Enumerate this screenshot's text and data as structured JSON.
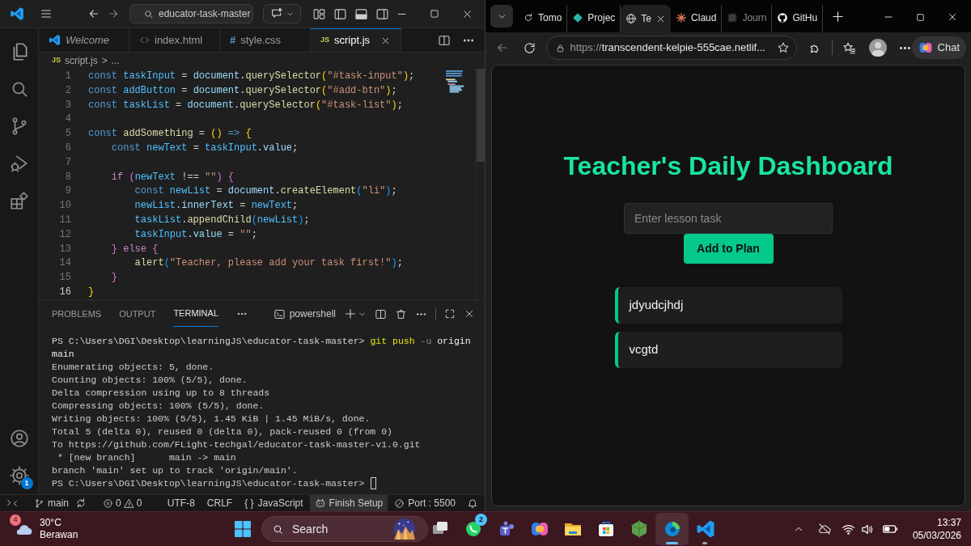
{
  "editor": {
    "search": "educator-task-master",
    "tabs": [
      {
        "kind": "welcome",
        "label": "Welcome",
        "selected": false
      },
      {
        "kind": "html",
        "label": "index.html",
        "selected": false
      },
      {
        "kind": "css",
        "badge": "#",
        "label": "style.css",
        "selected": false
      },
      {
        "kind": "js",
        "badge": "JS",
        "label": "script.js",
        "selected": true
      }
    ],
    "breadcrumb": {
      "badge": "JS",
      "file": "script.js",
      "separator": ">",
      "rest": "..."
    },
    "code_lines": [
      {
        "number": "1",
        "current": false,
        "segments": [
          {
            "kind": "kw",
            "text": "const "
          },
          {
            "kind": "cst",
            "text": "taskInput"
          },
          {
            "kind": "p",
            "text": " = "
          },
          {
            "kind": "var",
            "text": "document"
          },
          {
            "kind": "p",
            "text": "."
          },
          {
            "kind": "fn",
            "text": "querySelector"
          },
          {
            "kind": "b1",
            "text": "("
          },
          {
            "kind": "str",
            "text": "\"#task-input\""
          },
          {
            "kind": "b1",
            "text": ")"
          },
          {
            "kind": "p",
            "text": ";"
          }
        ]
      },
      {
        "number": "2",
        "current": false,
        "segments": [
          {
            "kind": "kw",
            "text": "const "
          },
          {
            "kind": "cst",
            "text": "addButton"
          },
          {
            "kind": "p",
            "text": " = "
          },
          {
            "kind": "var",
            "text": "document"
          },
          {
            "kind": "p",
            "text": "."
          },
          {
            "kind": "fn",
            "text": "querySelector"
          },
          {
            "kind": "b1",
            "text": "("
          },
          {
            "kind": "str",
            "text": "\"#add-btn\""
          },
          {
            "kind": "b1",
            "text": ")"
          },
          {
            "kind": "p",
            "text": ";"
          }
        ]
      },
      {
        "number": "3",
        "current": false,
        "segments": [
          {
            "kind": "kw",
            "text": "const "
          },
          {
            "kind": "cst",
            "text": "taskList"
          },
          {
            "kind": "p",
            "text": " = "
          },
          {
            "kind": "var",
            "text": "document"
          },
          {
            "kind": "p",
            "text": "."
          },
          {
            "kind": "fn",
            "text": "querySelector"
          },
          {
            "kind": "b1",
            "text": "("
          },
          {
            "kind": "str",
            "text": "\"#task-list\""
          },
          {
            "kind": "b1",
            "text": ")"
          },
          {
            "kind": "p",
            "text": ";"
          }
        ]
      },
      {
        "number": "4",
        "current": false
      },
      {
        "number": "5",
        "current": false,
        "segments": [
          {
            "kind": "kw",
            "text": "const "
          },
          {
            "kind": "fn",
            "text": "addSomething"
          },
          {
            "kind": "p",
            "text": " = "
          },
          {
            "kind": "b1",
            "text": "() "
          },
          {
            "kind": "kw",
            "text": "=> "
          },
          {
            "kind": "b1",
            "text": "{"
          }
        ]
      },
      {
        "number": "6",
        "current": false,
        "segments": [
          {
            "kind": "kw",
            "text": "    const "
          },
          {
            "kind": "cst",
            "text": "newText"
          },
          {
            "kind": "p",
            "text": " = "
          },
          {
            "kind": "cst",
            "text": "taskInput"
          },
          {
            "kind": "p",
            "text": "."
          },
          {
            "kind": "var",
            "text": "value"
          },
          {
            "kind": "p",
            "text": ";"
          }
        ]
      },
      {
        "number": "7",
        "current": false
      },
      {
        "number": "8",
        "current": false,
        "segments": [
          {
            "kind": "ctl",
            "text": "    if "
          },
          {
            "kind": "b2",
            "text": "("
          },
          {
            "kind": "cst",
            "text": "newText"
          },
          {
            "kind": "p",
            "text": " !== "
          },
          {
            "kind": "str",
            "text": "\"\""
          },
          {
            "kind": "b2",
            "text": ") {"
          }
        ]
      },
      {
        "number": "9",
        "current": false,
        "segments": [
          {
            "kind": "kw",
            "text": "        const "
          },
          {
            "kind": "cst",
            "text": "newList"
          },
          {
            "kind": "p",
            "text": " = "
          },
          {
            "kind": "var",
            "text": "document"
          },
          {
            "kind": "p",
            "text": "."
          },
          {
            "kind": "fn",
            "text": "createElement"
          },
          {
            "kind": "b3",
            "text": "("
          },
          {
            "kind": "str",
            "text": "\"li\""
          },
          {
            "kind": "b3",
            "text": ")"
          },
          {
            "kind": "p",
            "text": ";"
          }
        ]
      },
      {
        "number": "10",
        "current": false,
        "segments": [
          {
            "kind": "cst",
            "text": "        newList"
          },
          {
            "kind": "p",
            "text": "."
          },
          {
            "kind": "var",
            "text": "innerText"
          },
          {
            "kind": "p",
            "text": " = "
          },
          {
            "kind": "cst",
            "text": "newText"
          },
          {
            "kind": "p",
            "text": ";"
          }
        ]
      },
      {
        "number": "11",
        "current": false,
        "segments": [
          {
            "kind": "cst",
            "text": "        taskList"
          },
          {
            "kind": "p",
            "text": "."
          },
          {
            "kind": "fn",
            "text": "appendChild"
          },
          {
            "kind": "b3",
            "text": "("
          },
          {
            "kind": "cst",
            "text": "newList"
          },
          {
            "kind": "b3",
            "text": ")"
          },
          {
            "kind": "p",
            "text": ";"
          }
        ]
      },
      {
        "number": "12",
        "current": false,
        "segments": [
          {
            "kind": "cst",
            "text": "        taskInput"
          },
          {
            "kind": "p",
            "text": "."
          },
          {
            "kind": "var",
            "text": "value"
          },
          {
            "kind": "p",
            "text": " = "
          },
          {
            "kind": "str",
            "text": "\"\""
          },
          {
            "kind": "p",
            "text": ";"
          }
        ]
      },
      {
        "number": "13",
        "current": false,
        "segments": [
          {
            "kind": "b2",
            "text": "    } "
          },
          {
            "kind": "ctl",
            "text": "else "
          },
          {
            "kind": "b2",
            "text": "{"
          }
        ]
      },
      {
        "number": "14",
        "current": false,
        "segments": [
          {
            "kind": "fn",
            "text": "        alert"
          },
          {
            "kind": "b3",
            "text": "("
          },
          {
            "kind": "str",
            "text": "\"Teacher, please add your task first!\""
          },
          {
            "kind": "b3",
            "text": ")"
          },
          {
            "kind": "p",
            "text": ";"
          }
        ]
      },
      {
        "number": "15",
        "current": false,
        "segments": [
          {
            "kind": "b2",
            "text": "    }"
          }
        ]
      },
      {
        "number": "16",
        "current": true,
        "segments": [
          {
            "kind": "b1",
            "text": "}"
          }
        ]
      }
    ],
    "panel_tabs": [
      {
        "label": "PROBLEMS",
        "selected": false
      },
      {
        "label": "OUTPUT",
        "selected": false
      },
      {
        "label": "TERMINAL",
        "selected": true
      }
    ],
    "shell": "powershell",
    "terminal_lines": [
      {
        "segments": [
          {
            "kind": "p",
            "text": "PS C:\\Users\\DGI\\Desktop\\learningJS\\educator-task-master> "
          },
          {
            "kind": "cmd",
            "text": "git push "
          },
          {
            "kind": "flag",
            "text": "-u "
          },
          {
            "kind": "arg",
            "text": "origin main"
          }
        ]
      },
      {
        "text": "Enumerating objects: 5, done."
      },
      {
        "text": "Counting objects: 100% (5/5), done."
      },
      {
        "text": "Delta compression using up to 8 threads"
      },
      {
        "text": "Compressing objects: 100% (5/5), done."
      },
      {
        "text": "Writing objects: 100% (5/5), 1.45 KiB | 1.45 MiB/s, done."
      },
      {
        "text": "Total 5 (delta 0), reused 0 (delta 0), pack-reused 0 (from 0)"
      },
      {
        "text": "To https://github.com/FLight-techgal/educator-task-master-v1.0.git"
      },
      {
        "text": " * [new branch]      main -> main"
      },
      {
        "text": "branch 'main' set up to track 'origin/main'."
      },
      {
        "text": "PS C:\\Users\\DGI\\Desktop\\learningJS\\educator-task-master> ",
        "cursor": true
      }
    ],
    "settings_badge": "1",
    "status_bar": {
      "branch": "main",
      "errors": "0",
      "warnings": "0",
      "encoding": "UTF-8",
      "eol": "CRLF",
      "language_icon": "{ }",
      "language": "JavaScript",
      "setup": "Finish Setup",
      "port": "Port : 5500"
    }
  },
  "browser": {
    "tabs": [
      {
        "title": "Tomo",
        "selected": false,
        "sleeping": false
      },
      {
        "title": "Projec",
        "selected": false,
        "sleeping": false
      },
      {
        "title": "Te",
        "selected": true,
        "sleeping": false
      },
      {
        "title": "Claud",
        "selected": false,
        "sleeping": false
      },
      {
        "title": "Journ",
        "selected": false,
        "sleeping": true
      },
      {
        "title": "GitHu",
        "selected": false,
        "sleeping": false
      }
    ],
    "url_scheme": "https://",
    "url_rest": "transcendent-kelpie-555cae.netlif...",
    "chat": "Chat",
    "page": {
      "heading": "Teacher's Daily Dashboard",
      "input": {
        "placeholder": "Enter lesson task"
      },
      "button": "Add to Plan",
      "tasks": [
        "jdyudcjhdj",
        "vcgtd"
      ]
    }
  },
  "taskbar": {
    "weather": {
      "badge": "4",
      "temperature": "30°C",
      "condition": "Berawan"
    },
    "search": "Search",
    "apps": [
      {
        "active": false,
        "running": false
      },
      {
        "active": false,
        "running": false,
        "badge": "2"
      },
      {
        "active": false,
        "running": false
      },
      {
        "active": false,
        "running": false
      },
      {
        "active": false,
        "running": false
      },
      {
        "active": false,
        "running": false
      },
      {
        "active": false,
        "running": false
      },
      {
        "active": true,
        "running": true
      },
      {
        "active": false,
        "running": true
      }
    ],
    "time": "13:37",
    "date": "05/03/2026"
  }
}
